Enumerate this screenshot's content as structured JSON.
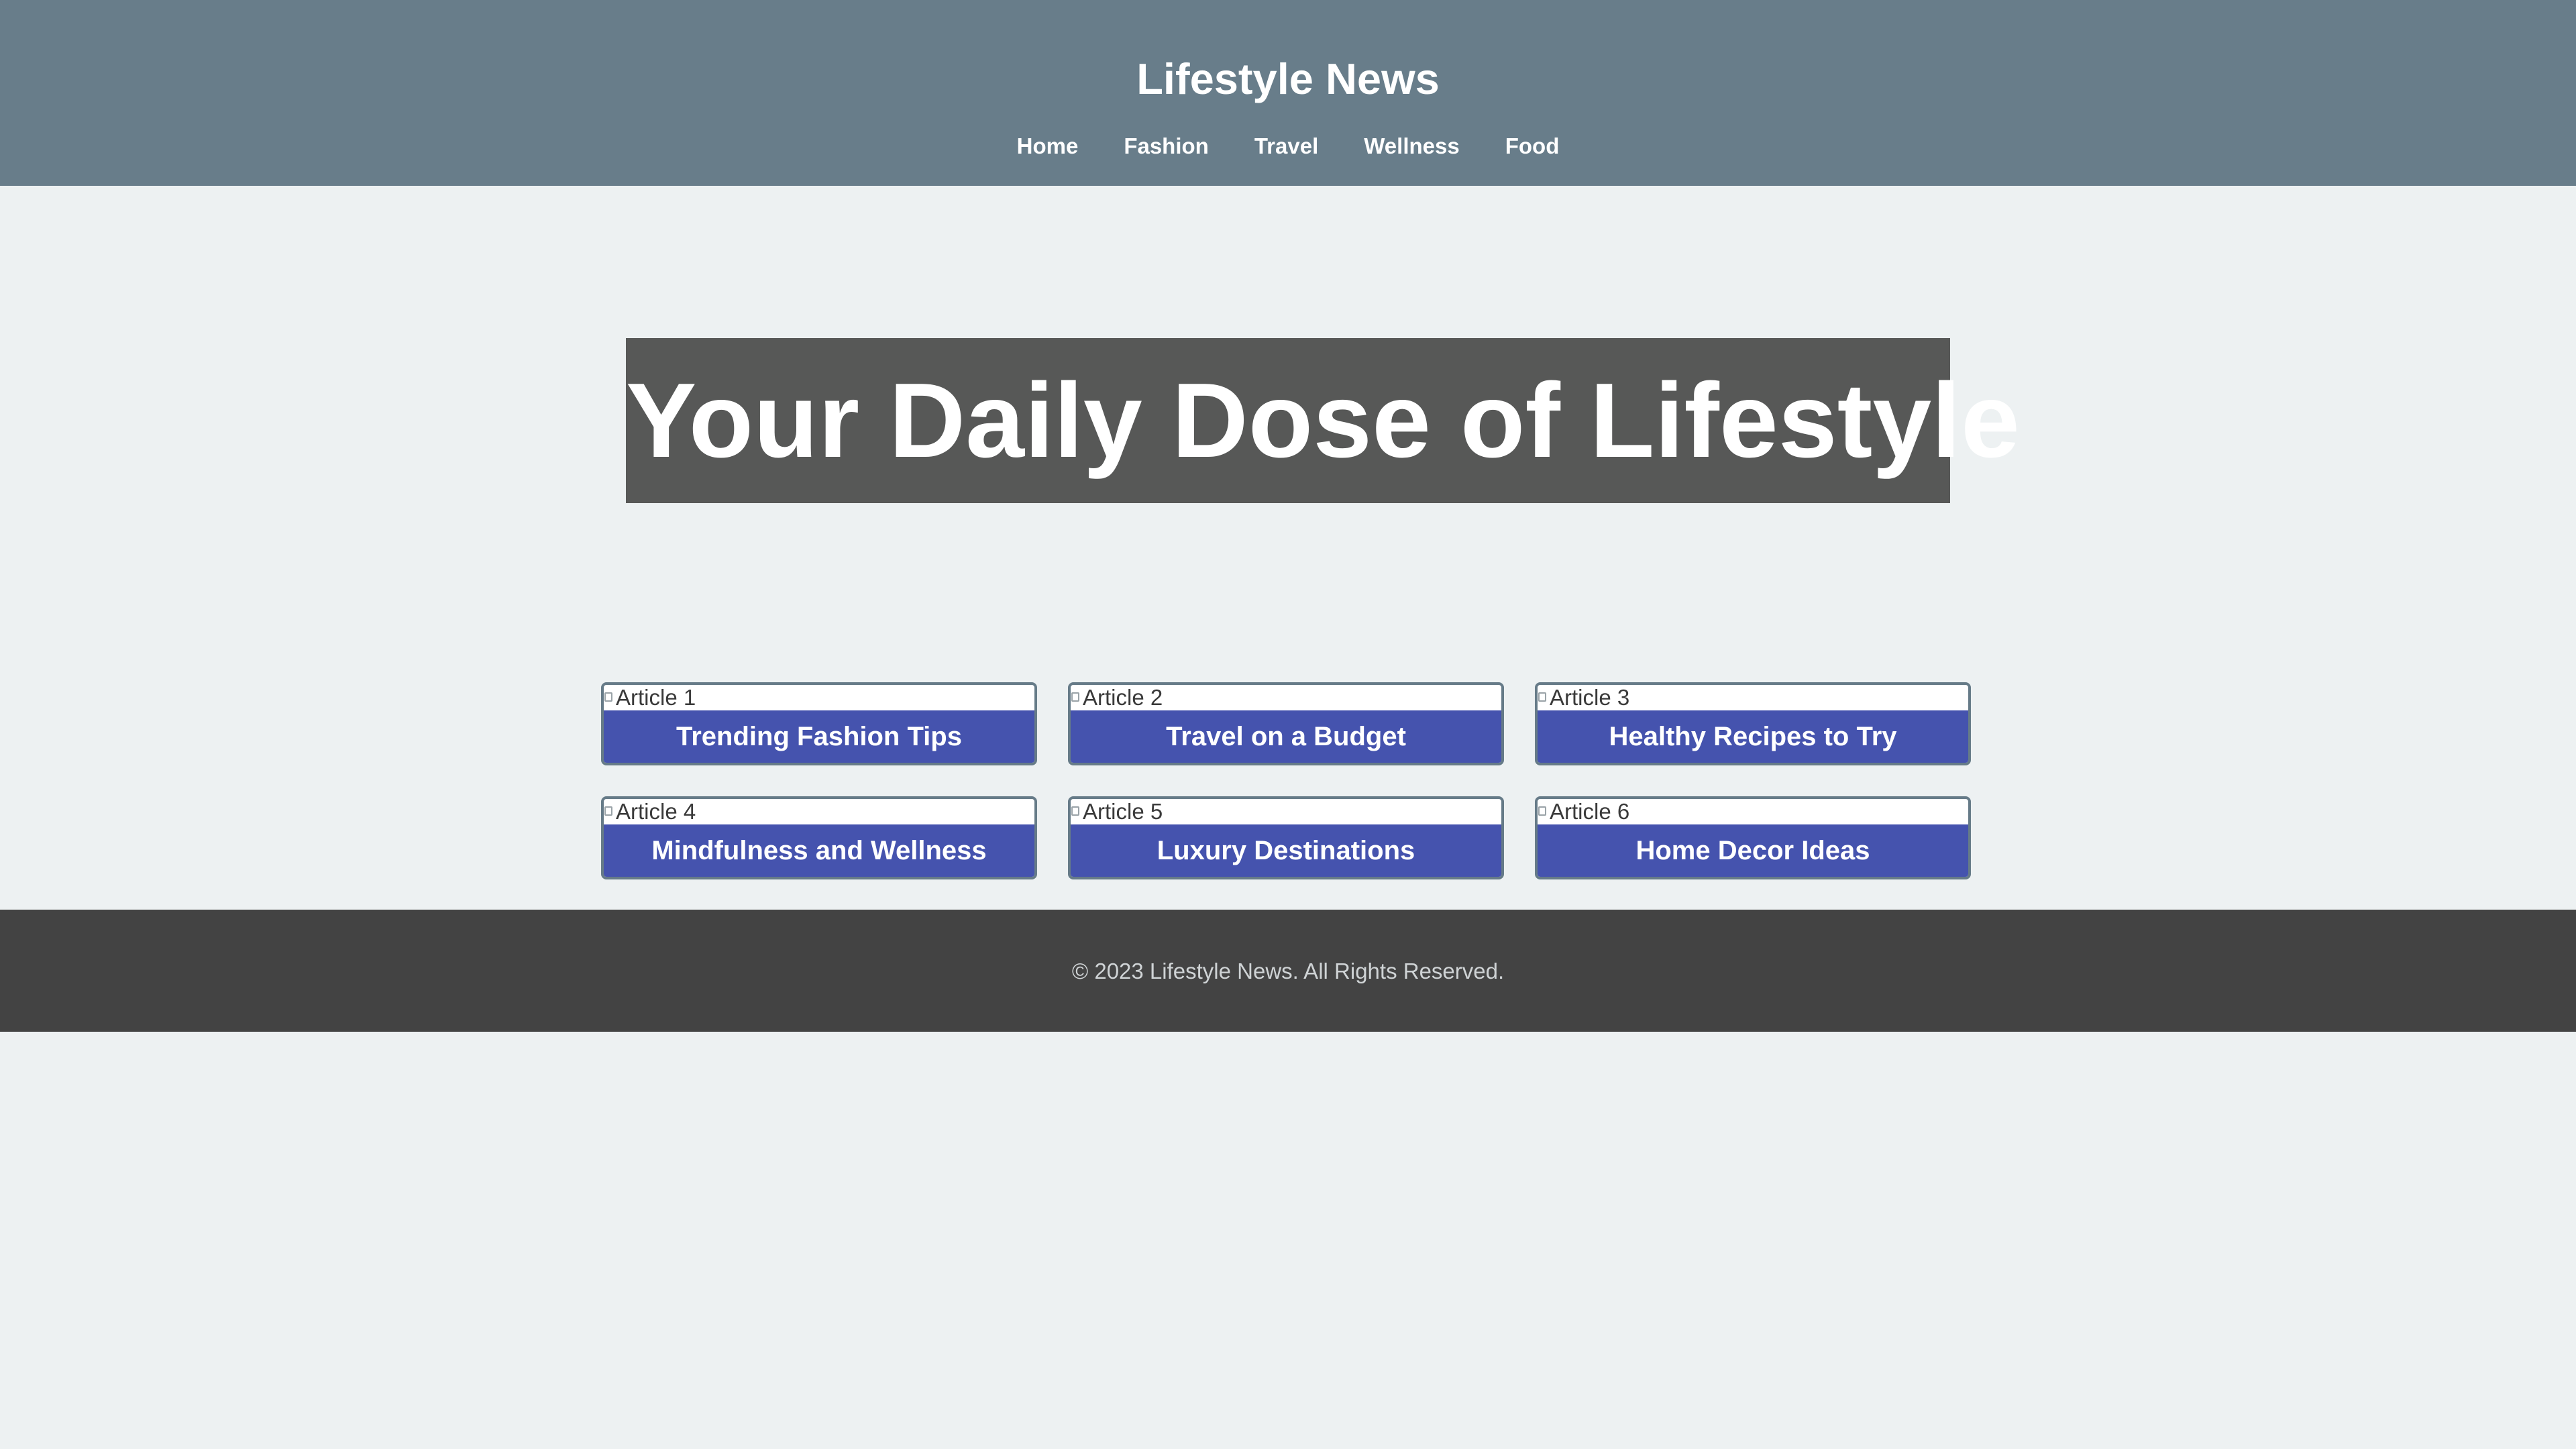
{
  "header": {
    "title": "Lifestyle News",
    "nav": [
      "Home",
      "Fashion",
      "Travel",
      "Wellness",
      "Food"
    ]
  },
  "hero": {
    "headline": "Your Daily Dose of Lifestyle"
  },
  "articles": [
    {
      "image_alt": "Article 1",
      "title": "Trending Fashion Tips"
    },
    {
      "image_alt": "Article 2",
      "title": "Travel on a Budget"
    },
    {
      "image_alt": "Article 3",
      "title": "Healthy Recipes to Try"
    },
    {
      "image_alt": "Article 4",
      "title": "Mindfulness and Wellness"
    },
    {
      "image_alt": "Article 5",
      "title": "Luxury Destinations"
    },
    {
      "image_alt": "Article 6",
      "title": "Home Decor Ideas"
    }
  ],
  "footer": {
    "copyright": "© 2023 Lifestyle News. All Rights Reserved."
  },
  "colors": {
    "header_bg": "#687d8a",
    "hero_bg": "#575857",
    "card_title_bg": "#4553ae",
    "card_border": "#667b88",
    "footer_bg": "#434343",
    "page_bg": "#edf1f2"
  }
}
